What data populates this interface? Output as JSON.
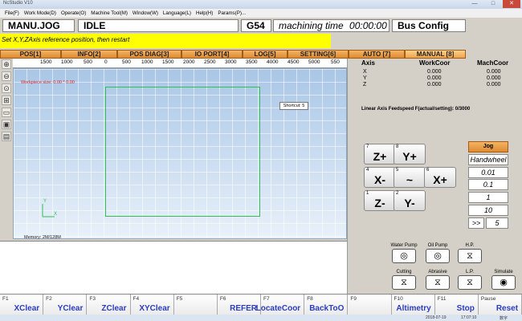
{
  "window": {
    "title": "NcStudio V10",
    "btn_min": "—",
    "btn_max": "□",
    "btn_close": "✕"
  },
  "menu": [
    "File(F)",
    "Work Mode(D)",
    "Operate(O)",
    "Machine Tool(M)",
    "Window(W)",
    "Language(L)",
    "Help(H)",
    "Params(P)..."
  ],
  "status": {
    "mode": "MANU.JOG",
    "state": "IDLE",
    "coord_sys": "G54",
    "machining_time_label": "machining time",
    "machining_time": "00:00:00",
    "bus_config": "Bus Config"
  },
  "message": "Set X,Y,ZAxis reference position, then restart",
  "tabs": [
    "POS[1]",
    "INFO[2]",
    "POS DIAG[3]",
    "IO PORT[4]",
    "LOG[5]",
    "SETTING[6]",
    "AUTO [7]",
    "MANUAL [8]"
  ],
  "active_tab_index": 7,
  "left_tools": [
    "⊕",
    "⊖",
    "⊙",
    "⊞",
    "▭",
    "▣",
    "▤",
    "▥"
  ],
  "ruler": [
    "1500",
    "1000",
    "500",
    "0",
    "500",
    "1000",
    "1500",
    "2000",
    "2500",
    "3000",
    "3500",
    "4000",
    "4500",
    "5000",
    "550"
  ],
  "canvas": {
    "workpiece_label": "Workpiece size:",
    "workpiece_value": "0.00 * 0.00",
    "shortcut_tip": "Shortcut: 5",
    "memory": "Memory: 2M/128M",
    "axis_y": "Y",
    "axis_x": "X"
  },
  "coords": {
    "axis_header": "Axis",
    "work_header": "WorkCoor",
    "mach_header": "MachCoor",
    "rows": [
      {
        "axis": "X",
        "work": "0.000",
        "mach": "0.000"
      },
      {
        "axis": "Y",
        "work": "0.000",
        "mach": "0.000"
      },
      {
        "axis": "Z",
        "work": "0.000",
        "mach": "0.000"
      }
    ]
  },
  "feedspeed": "Linear Axis Feedspeed F(actual/setting): 0/3000",
  "jog": {
    "z_plus": {
      "num": "7",
      "label": "Z+"
    },
    "y_plus": {
      "num": "8",
      "label": "Y+"
    },
    "x_minus": {
      "num": "4",
      "label": "X-"
    },
    "center": {
      "num": "5",
      "label": "~"
    },
    "x_plus": {
      "num": "6",
      "label": "X+"
    },
    "z_minus": {
      "num": "1",
      "label": "Z-"
    },
    "y_minus": {
      "num": "2",
      "label": "Y-"
    }
  },
  "step": {
    "jog_tab": "Jog",
    "handwheel": "Handwheel",
    "s001": "0.01",
    "s01": "0.1",
    "s1": "1",
    "s10": "10",
    "more": ">>",
    "five": "5"
  },
  "tools": {
    "water_pump": "Water Pump",
    "oil_pump": "Oil Pump",
    "hp": "H.P.",
    "cutting": "Cutting",
    "abrasive": "Abrasive",
    "lp": "L.P.",
    "simulate": "Simulate"
  },
  "fkeys": [
    {
      "fn": "F1",
      "act": "XClear"
    },
    {
      "fn": "F2",
      "act": "YClear"
    },
    {
      "fn": "F3",
      "act": "ZClear"
    },
    {
      "fn": "F4",
      "act": "XYClear"
    },
    {
      "fn": "F5",
      "act": ""
    },
    {
      "fn": "F6",
      "act": "REFER"
    },
    {
      "fn": "F7",
      "act": "LocateCoor"
    },
    {
      "fn": "F8",
      "act": "BackToO"
    },
    {
      "fn": "F9",
      "act": ""
    },
    {
      "fn": "F10",
      "act": "Altimetry"
    },
    {
      "fn": "F11",
      "act": "Stop"
    },
    {
      "fn": "Pause",
      "act": "Reset"
    }
  ],
  "taskbar": {
    "date": "2018-07-19",
    "time": "17:07:10",
    "ime": "数字"
  },
  "colors": {
    "message_bg": "#ffff00",
    "tab": "#e08a30",
    "workpiece_border": "#2fc14f",
    "workpiece_label": "#d22222"
  }
}
